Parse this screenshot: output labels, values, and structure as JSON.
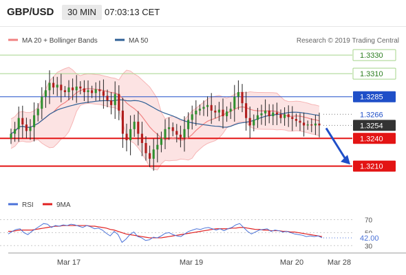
{
  "header": {
    "symbol": "GBP/USD",
    "timeframe": "30 MIN",
    "time": "07:03:13 CET"
  },
  "legend": {
    "items": [
      {
        "label": "MA 20 + Bollinger Bands",
        "color": "#f08080"
      },
      {
        "label": "MA 50",
        "color": "#2e5f96"
      }
    ],
    "credit": "Research © 2019 Trading Central"
  },
  "rsi_legend": {
    "items": [
      {
        "label": "RSI",
        "color": "#4a72d8"
      },
      {
        "label": "9MA",
        "color": "#e02020"
      }
    ]
  },
  "chart_data": [
    {
      "type": "candlestick",
      "symbol": "GBP/USD",
      "timeframe": "30 MIN",
      "ylim": [
        1.318,
        1.3345
      ],
      "x_labels": [
        "Mar 17",
        "Mar 19",
        "Mar 20",
        "Mar 28"
      ],
      "levels": [
        {
          "value": 1.333,
          "label": "1.3330",
          "kind": "resistance",
          "color": "#a5d48a"
        },
        {
          "value": 1.331,
          "label": "1.3310",
          "kind": "resistance",
          "color": "#a5d48a"
        },
        {
          "value": 1.3285,
          "label": "1.3285",
          "kind": "pivot",
          "color": "#1f4fc8"
        },
        {
          "value": 1.3266,
          "label": "1.3266",
          "kind": "reference",
          "color": "#999999"
        },
        {
          "value": 1.3254,
          "label": "1.3254",
          "kind": "last_price",
          "color": "#333333"
        },
        {
          "value": 1.324,
          "label": "1.3240",
          "kind": "support",
          "color": "#e31414"
        },
        {
          "value": 1.321,
          "label": "1.3210",
          "kind": "support",
          "color": "#e31414"
        }
      ],
      "forecast_arrow": {
        "from": 1.3254,
        "to": 1.3214,
        "direction": "down"
      },
      "close": [
        1.3245,
        1.325,
        1.3262,
        1.3255,
        1.3248,
        1.3252,
        1.3265,
        1.3272,
        1.3285,
        1.3292,
        1.33,
        1.3295,
        1.3298,
        1.3292,
        1.329,
        1.3295,
        1.3292,
        1.3296,
        1.3294,
        1.329,
        1.3292,
        1.3289,
        1.3293,
        1.3291,
        1.3286,
        1.3281,
        1.3276,
        1.3288,
        1.327,
        1.3245,
        1.3238,
        1.325,
        1.3258,
        1.3245,
        1.3235,
        1.3224,
        1.3218,
        1.3228,
        1.3233,
        1.324,
        1.325,
        1.3252,
        1.3248,
        1.3244,
        1.3241,
        1.325,
        1.326,
        1.3266,
        1.327,
        1.3272,
        1.3274,
        1.3276,
        1.327,
        1.3268,
        1.3271,
        1.3264,
        1.3269,
        1.3272,
        1.3285,
        1.329,
        1.3278,
        1.3262,
        1.3254,
        1.326,
        1.3265,
        1.3267,
        1.327,
        1.3264,
        1.3268,
        1.3266,
        1.3262,
        1.3266,
        1.3263,
        1.3261,
        1.3259,
        1.3257,
        1.3254,
        1.3255,
        1.3254,
        1.3256,
        1.3254
      ],
      "rsi": {
        "ylim": [
          25,
          78
        ],
        "levels": [
          70,
          50,
          30
        ],
        "current": 42.0,
        "current_label": "42.00",
        "rsi_values": [
          48,
          52,
          55,
          56,
          50,
          47,
          52,
          56,
          60,
          64,
          63,
          58,
          61,
          60,
          62,
          61,
          63,
          62,
          60,
          58,
          61,
          59,
          56,
          57,
          54,
          49,
          45,
          52,
          47,
          35,
          40,
          47,
          51,
          44,
          42,
          38,
          39,
          43,
          42,
          45,
          49,
          50,
          47,
          45,
          44,
          48,
          52,
          54,
          56,
          55,
          57,
          58,
          56,
          54,
          56,
          53,
          56,
          58,
          62,
          64,
          58,
          52,
          48,
          51,
          54,
          55,
          56,
          52,
          54,
          53,
          51,
          52,
          50,
          48,
          47,
          46,
          44,
          45,
          44,
          45,
          42
        ],
        "ma9_values": [
          52,
          52,
          53,
          54,
          54,
          54,
          54,
          55,
          56,
          57,
          58,
          59,
          60,
          60,
          61,
          61,
          61,
          61,
          61,
          61,
          61,
          60,
          60,
          59,
          58,
          57,
          55,
          54,
          52,
          50,
          48,
          47,
          46,
          45,
          44,
          43,
          42,
          42,
          42,
          42,
          43,
          44,
          45,
          46,
          47,
          48,
          49,
          50,
          51,
          52,
          53,
          54,
          55,
          56,
          56,
          56,
          56,
          57,
          57,
          58,
          58,
          57,
          56,
          55,
          55,
          54,
          54,
          53,
          53,
          53,
          52,
          52,
          51,
          51,
          50,
          49,
          48,
          47,
          46,
          45,
          44
        ]
      }
    }
  ]
}
